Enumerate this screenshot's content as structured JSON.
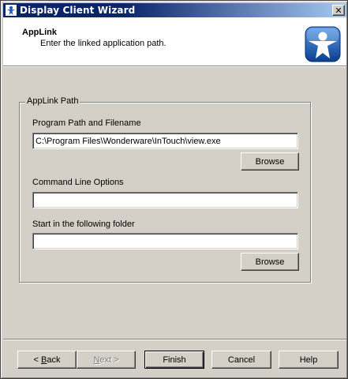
{
  "window": {
    "title": "Display Client Wizard",
    "close_glyph": "✕"
  },
  "header": {
    "title": "AppLink",
    "subtitle": "Enter the linked application path.",
    "logo_icon": "thinmanager-person-icon"
  },
  "group": {
    "legend": "AppLink Path",
    "program_path_label": "Program Path and Filename",
    "program_path_value": "C:\\Program Files\\Wonderware\\InTouch\\view.exe",
    "browse_label_1": "Browse",
    "command_line_label": "Command Line Options",
    "command_line_value": "",
    "start_folder_label": "Start in the following folder",
    "start_folder_value": "",
    "browse_label_2": "Browse"
  },
  "footer": {
    "back_prefix": "< ",
    "back_mnemonic": "B",
    "back_rest": "ack",
    "next_mnemonic": "N",
    "next_rest": "ext >",
    "finish_label": "Finish",
    "cancel_label": "Cancel",
    "help_label": "Help"
  },
  "colors": {
    "titlebar_start": "#0a246a",
    "titlebar_end": "#a6caf0",
    "face": "#d4d0c8",
    "logo_blue": "#1e5fb4"
  }
}
